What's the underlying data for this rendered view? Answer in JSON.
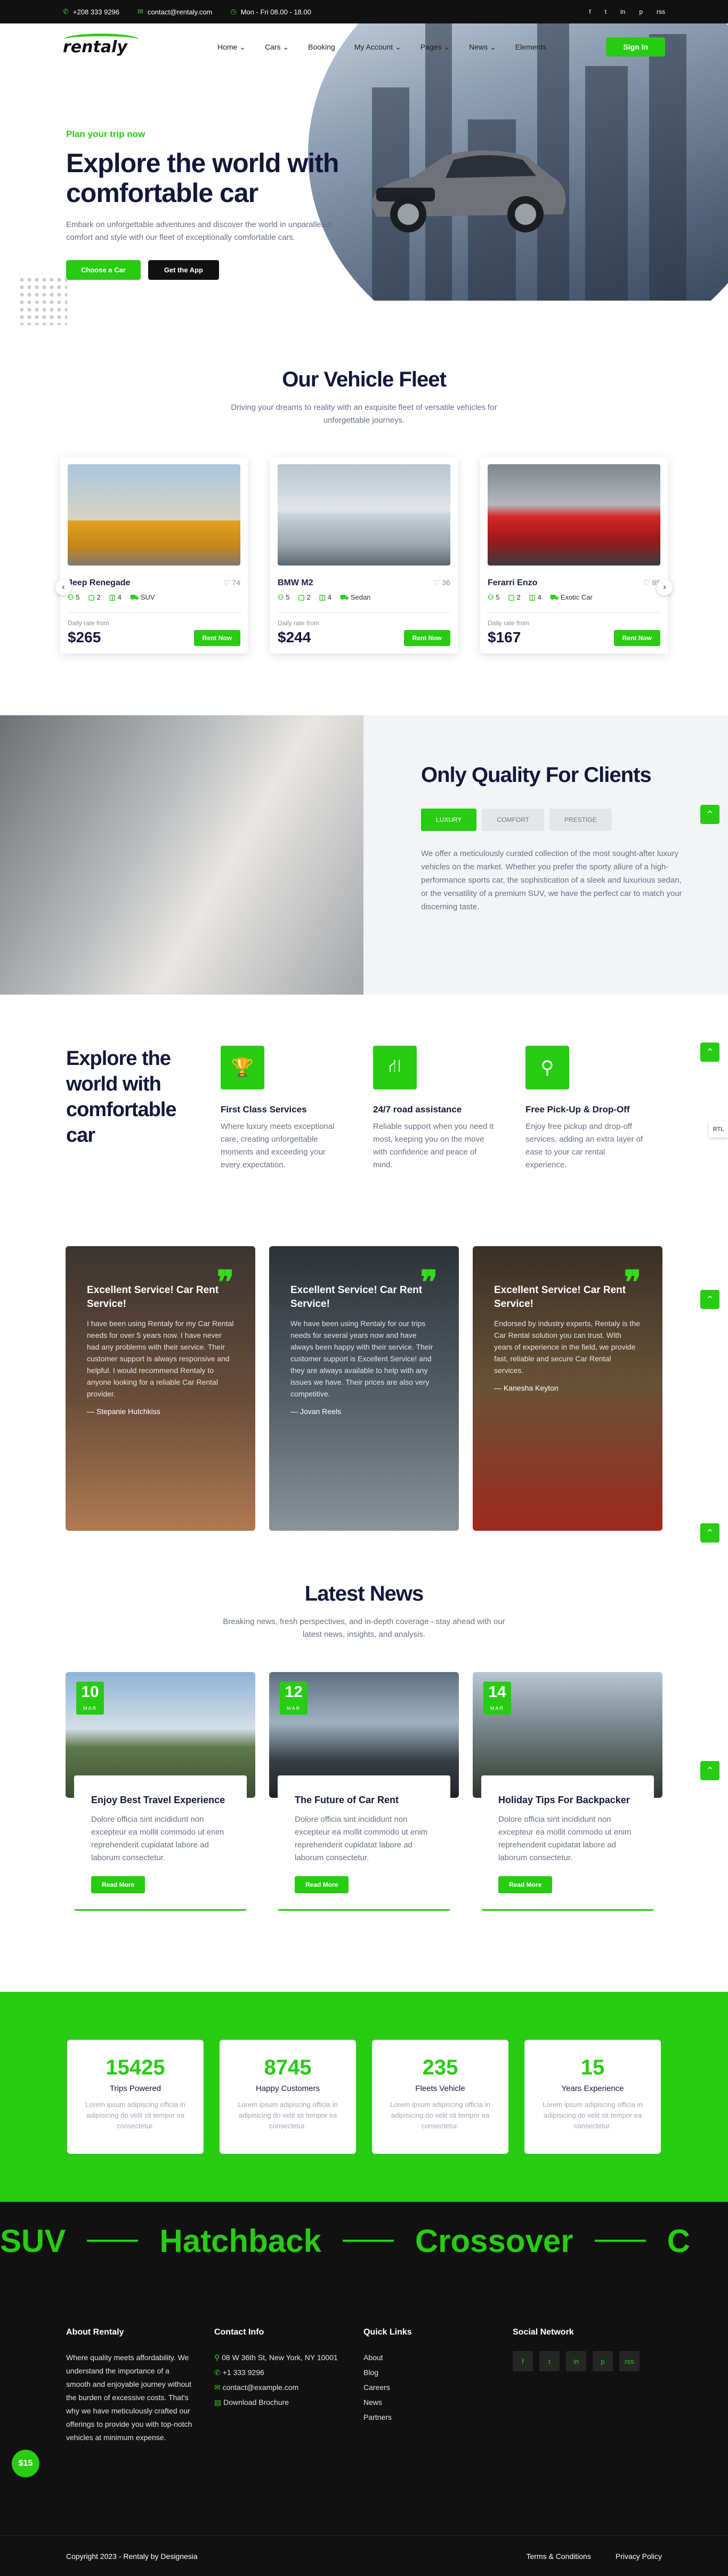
{
  "topbar": {
    "phone": "+208 333 9296",
    "email": "contact@rentaly.com",
    "hours": "Mon - Fri 08.00 - 18.00",
    "social": [
      "f",
      "t",
      "in",
      "p",
      "rss"
    ]
  },
  "header": {
    "logo": "rentaly",
    "nav": [
      "Home ⌄",
      "Cars ⌄",
      "Booking",
      "My Account ⌄",
      "Pages ⌄",
      "News ⌄",
      "Elements"
    ],
    "signin": "Sign In"
  },
  "hero": {
    "kicker": "Plan your trip now",
    "title": "Explore the world with comfortable car",
    "text": "Embark on unforgettable adventures and discover the world in unparalleled comfort and style with our fleet of exceptionally comfortable cars.",
    "btn1": "Choose a Car",
    "btn2": "Get the App"
  },
  "fleet": {
    "title": "Our Vehicle Fleet",
    "sub": "Driving your dreams to reality with an exquisite fleet of versatile vehicles for unforgettable journeys.",
    "cars": [
      {
        "name": "Jeep Renegade",
        "likes": "74",
        "seats": "5",
        "bags": "2",
        "doors": "4",
        "type": "SUV",
        "rate_label": "Daily rate from",
        "price": "$265",
        "btn": "Rent Now",
        "color": "#e2a21f"
      },
      {
        "name": "BMW M2",
        "likes": "36",
        "seats": "5",
        "bags": "2",
        "doors": "4",
        "type": "Sedan",
        "rate_label": "Daily rate from",
        "price": "$244",
        "btn": "Rent Now",
        "color": "#c9d2dc"
      },
      {
        "name": "Ferarri Enzo",
        "likes": "85",
        "seats": "5",
        "bags": "2",
        "doors": "4",
        "type": "Exotic Car",
        "rate_label": "Daily rate from",
        "price": "$167",
        "btn": "Rent Now",
        "color": "#d52626"
      }
    ]
  },
  "quality": {
    "title": "Only Quality For Clients",
    "tabs": [
      "LUXURY",
      "COMFORT",
      "PRESTIGE"
    ],
    "text": "We offer a meticulously curated collection of the most sought-after luxury vehicles on the market. Whether you prefer the sporty allure of a high-performance sports car, the sophistication of a sleek and luxurious sedan, or the versatility of a premium SUV, we have the perfect car to match your discerning taste."
  },
  "services": {
    "title": "Explore the world with comfortable car",
    "items": [
      {
        "title": "First Class Services",
        "text": "Where luxury meets exceptional care, creating unforgettable moments and exceeding your every expectation."
      },
      {
        "title": "24/7 road assistance",
        "text": "Reliable support when you need it most, keeping you on the move with confidence and peace of mind."
      },
      {
        "title": "Free Pick-Up & Drop-Off",
        "text": "Enjoy free pickup and drop-off services, adding an extra layer of ease to your car rental experience."
      }
    ]
  },
  "testimonials": [
    {
      "title": "Excellent Service! Car Rent Service!",
      "text": "I have been using Rentaly for my Car Rental needs for over 5 years now. I have never had any problems with their service. Their customer support is always responsive and helpful. I would recommend Rentaly to anyone looking for a reliable Car Rental provider.",
      "who": "Stepanie Hutchkiss"
    },
    {
      "title": "Excellent Service! Car Rent Service!",
      "text": "We have been using Rentaly for our trips needs for several years now and have always been happy with their service. Their customer support is Excellent Service! and they are always available to help with any issues we have. Their prices are also very competitive.",
      "who": "Jovan Reels"
    },
    {
      "title": "Excellent Service! Car Rent Service!",
      "text": "Endorsed by industry experts, Rentaly is the Car Rental solution you can trust. With years of experience in the field, we provide fast, reliable and secure Car Rental services.",
      "who": "Kanesha Keyton"
    }
  ],
  "news": {
    "title": "Latest News",
    "sub": "Breaking news, fresh perspectives, and in-depth coverage - stay ahead with our latest news, insights, and analysis.",
    "items": [
      {
        "day": "10",
        "mon": "MAR",
        "title": "Enjoy Best Travel Experience",
        "text": "Dolore officia sint incididunt non excepteur ea mollit commodo ut enim reprehenderit cupidatat labore ad laborum consectetur.",
        "btn": "Read More"
      },
      {
        "day": "12",
        "mon": "MAR",
        "title": "The Future of Car Rent",
        "text": "Dolore officia sint incididunt non excepteur ea mollit commodo ut enim reprehenderit cupidatat labore ad laborum consectetur.",
        "btn": "Read More"
      },
      {
        "day": "14",
        "mon": "MAR",
        "title": "Holiday Tips For Backpacker",
        "text": "Dolore officia sint incididunt non excepteur ea mollit commodo ut enim reprehenderit cupidatat labore ad laborum consectetur.",
        "btn": "Read More"
      }
    ]
  },
  "stats": [
    {
      "num": "15425",
      "label": "Trips Powered",
      "desc": "Lorem ipsum adipiscing officia in adipisicing do velit sit tempor ea consectetur."
    },
    {
      "num": "8745",
      "label": "Happy Customers",
      "desc": "Lorem ipsum adipiscing officia in adipisicing do velit sit tempor ea consectetur."
    },
    {
      "num": "235",
      "label": "Fleets Vehicle",
      "desc": "Lorem ipsum adipiscing officia in adipisicing do velit sit tempor ea consectetur."
    },
    {
      "num": "15",
      "label": "Years Experience",
      "desc": "Lorem ipsum adipiscing officia in adipisicing do velit sit tempor ea consectetur."
    }
  ],
  "marquee": [
    "SUV",
    "Hatchback",
    "Crossover",
    "C"
  ],
  "footer": {
    "about_title": "About Rentaly",
    "about": "Where quality meets affordability. We understand the importance of a smooth and enjoyable journey without the burden of excessive costs. That's why we have meticulously crafted our offerings to provide you with top-notch vehicles at minimum expense.",
    "contact_title": "Contact Info",
    "address": "08 W 36th St, New York, NY 10001",
    "phone": "+1 333 9296",
    "email": "contact@example.com",
    "brochure": "Download Brochure",
    "links_title": "Quick Links",
    "links": [
      "About",
      "Blog",
      "Careers",
      "News",
      "Partners"
    ],
    "social_title": "Social Network",
    "copyright": "Copyright 2023 - Rentaly by Designesia",
    "terms": "Terms & Conditions",
    "privacy": "Privacy Policy"
  },
  "misc": {
    "badge": "$15",
    "rtl": "RTL"
  }
}
